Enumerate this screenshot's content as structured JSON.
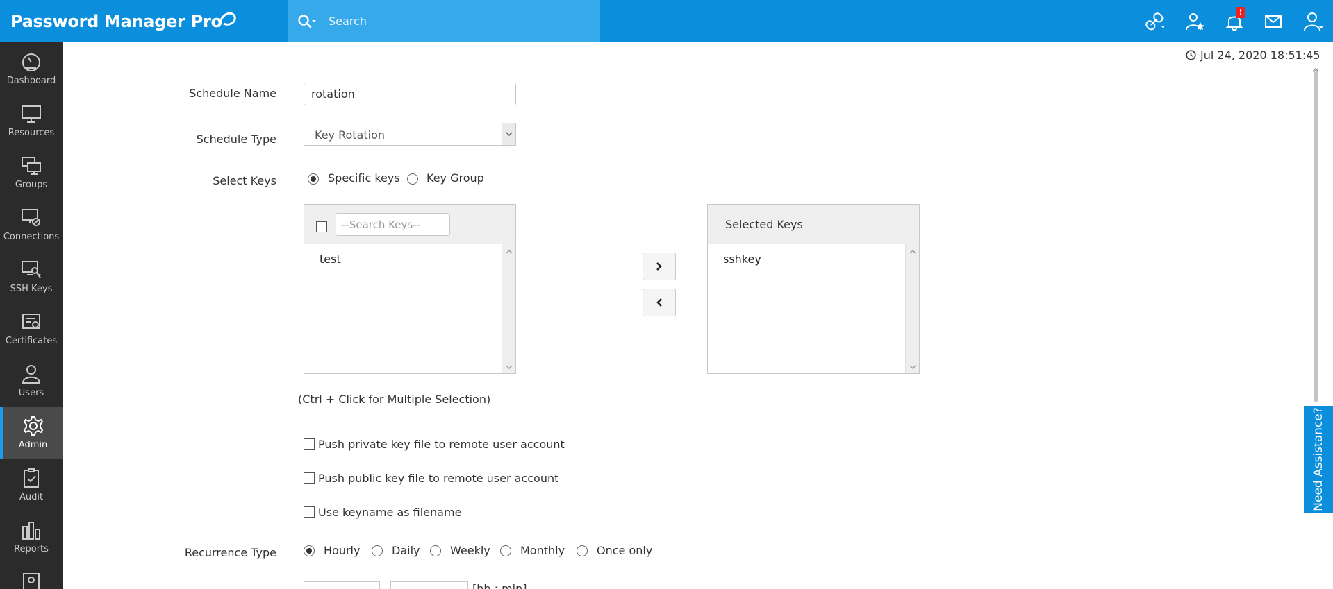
{
  "app": {
    "brand": "Password Manager Pro",
    "search_placeholder": "Search",
    "notification_count": "!",
    "datetime": "Jul 24, 2020 18:51:45"
  },
  "sidebar": {
    "items": [
      {
        "label": "Dashboard",
        "icon": "dashboard-icon"
      },
      {
        "label": "Resources",
        "icon": "monitor-icon"
      },
      {
        "label": "Groups",
        "icon": "groups-icon"
      },
      {
        "label": "Connections",
        "icon": "connections-icon"
      },
      {
        "label": "SSH Keys",
        "icon": "ssh-key-icon"
      },
      {
        "label": "Certificates",
        "icon": "certificate-icon"
      },
      {
        "label": "Users",
        "icon": "user-icon"
      },
      {
        "label": "Admin",
        "icon": "gear-icon",
        "active": true
      },
      {
        "label": "Audit",
        "icon": "clipboard-check-icon"
      },
      {
        "label": "Reports",
        "icon": "bar-chart-icon"
      }
    ]
  },
  "form": {
    "schedule_name_label": "Schedule Name",
    "schedule_name_value": "rotation",
    "schedule_type_label": "Schedule Type",
    "schedule_type_value": "Key Rotation",
    "select_keys_label": "Select Keys",
    "select_keys_options": [
      "Specific keys",
      "Key Group"
    ],
    "select_keys_selected": "Specific keys",
    "available_keys": {
      "search_placeholder": "--Search Keys--",
      "items": [
        "test"
      ]
    },
    "selected_keys": {
      "header": "Selected Keys",
      "items": [
        "sshkey"
      ]
    },
    "hint": "(Ctrl + Click for Multiple Selection)",
    "checkboxes": [
      {
        "label": "Push private key file to remote user account",
        "checked": false
      },
      {
        "label": "Push public key file to remote user account",
        "checked": false
      },
      {
        "label": "Use keyname as filename",
        "checked": false
      }
    ],
    "recurrence_label": "Recurrence Type",
    "recurrence_options": [
      "Hourly",
      "Daily",
      "Weekly",
      "Monthly",
      "Once only"
    ],
    "recurrence_selected": "Hourly",
    "start_time_hint": "[hh : min]"
  },
  "assist": {
    "label": "Need Assistance?"
  },
  "colors": {
    "topbar": "#0b8fdd",
    "search": "#36a9ea",
    "sidebar": "#2b2b2b",
    "active_accent": "#1b9cea"
  }
}
